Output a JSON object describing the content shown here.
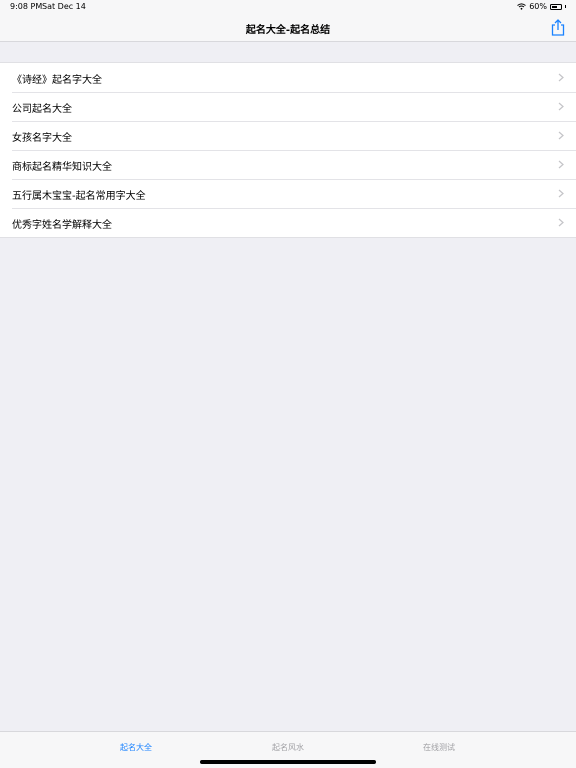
{
  "status_bar": {
    "time": "9:08 PM",
    "date": "Sat Dec 14",
    "battery": "60%",
    "battery_level": 0.6,
    "icons": [
      "wifi-icon",
      "battery-icon"
    ]
  },
  "nav": {
    "title": "起名大全-起名总结",
    "share_icon": "share-icon"
  },
  "list": {
    "items": [
      {
        "label": "《诗经》起名字大全"
      },
      {
        "label": "公司起名大全"
      },
      {
        "label": "女孩名字大全"
      },
      {
        "label": "商标起名精华知识大全"
      },
      {
        "label": "五行属木宝宝-起名常用字大全"
      },
      {
        "label": "优秀字姓名学解释大全"
      }
    ]
  },
  "tabs": [
    {
      "label": "起名大全",
      "active": true
    },
    {
      "label": "起名风水",
      "active": false
    },
    {
      "label": "在线测试",
      "active": false
    }
  ],
  "colors": {
    "accent": "#1a82ff",
    "background": "#efeff4",
    "inactive_tab": "#a0a0a4"
  }
}
